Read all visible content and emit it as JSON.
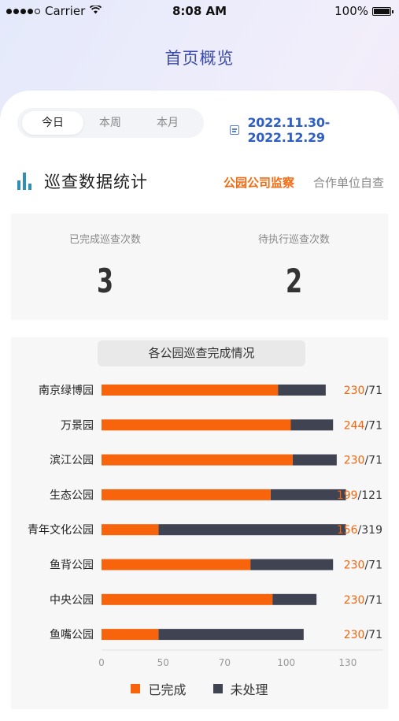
{
  "status_bar": {
    "carrier": "Carrier",
    "time": "8:08 AM",
    "battery": "100%"
  },
  "header": {
    "title": "首页概览"
  },
  "period_tabs": {
    "items": [
      "今日",
      "本周",
      "本月"
    ],
    "active": "今日"
  },
  "date_range": "2022.11.30-2022.12.29",
  "section": {
    "title": "巡查数据统计",
    "filters": [
      {
        "label": "公园公司监察",
        "active": true
      },
      {
        "label": "合作单位自查",
        "active": false
      }
    ]
  },
  "stats": {
    "completed_label": "已完成巡查次数",
    "completed_value": "3",
    "pending_label": "待执行巡查次数",
    "pending_value": "2"
  },
  "chart_title": "各公园巡查完成情况",
  "colors": {
    "completed": "#f7640b",
    "pending": "#3f4352",
    "accent_blue": "#2f5fc4",
    "title_blue": "#3a4aa8"
  },
  "chart_data": {
    "type": "bar",
    "orientation": "horizontal",
    "stacked": true,
    "title": "各公园巡查完成情况",
    "categories": [
      "南京绿博园",
      "万景园",
      "滨江公园",
      "生态公园",
      "青年文化公园",
      "鱼背公园",
      "中央公园",
      "鱼嘴公园"
    ],
    "series": [
      {
        "name": "已完成",
        "values": [
          230,
          244,
          230,
          199,
          156,
          230,
          230,
          230
        ]
      },
      {
        "name": "未处理",
        "values": [
          71,
          71,
          71,
          121,
          319,
          71,
          71,
          71
        ]
      }
    ],
    "bar_visual": {
      "completed_end": [
        96,
        103,
        104,
        92,
        31,
        81,
        93,
        31
      ],
      "total_end": [
        122,
        126,
        128,
        133,
        133,
        126,
        117,
        110
      ]
    },
    "axis_ticks": [
      "0",
      "50",
      "70",
      "100",
      "130"
    ],
    "legend": [
      "已完成",
      "未处理"
    ],
    "legend_position": "bottom"
  }
}
